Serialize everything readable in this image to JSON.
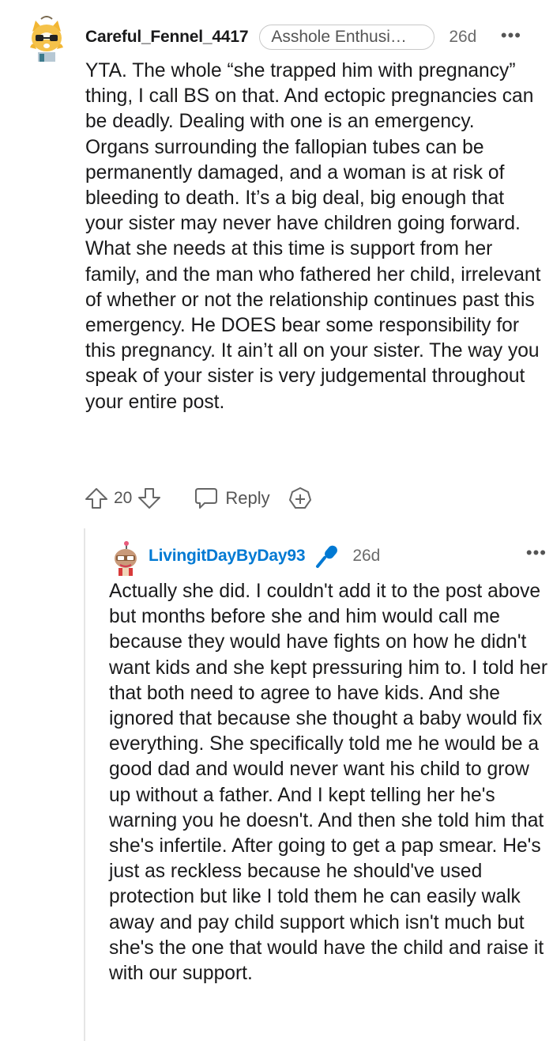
{
  "comment": {
    "username": "Careful_Fennel_4417",
    "flair": "Asshole Enthusi…",
    "time": "26d",
    "more": "•••",
    "body": "YTA. The whole “she trapped him with pregnancy” thing, I call BS on that. And ectopic pregnancies can be deadly. Dealing with one is an emergency. Organs surrounding the fallopian tubes can be permanently damaged, and a woman is at risk of bleeding to death. It’s a big deal, big enough that your sister may never have children going forward. What she needs at this time is support from her family, and the man who fathered her child, irrelevant of whether or not the relationship continues past this emergency. He DOES bear some responsibility for this pregnancy. It ain’t all on your sister. The way you speak of your sister is very judgemental throughout your entire post.",
    "vote_count": "20",
    "reply_label": "Reply",
    "icons": [
      "upvote-icon",
      "downvote-icon",
      "reply-icon",
      "award-icon"
    ]
  },
  "reply": {
    "username": "LivingitDayByDay93",
    "time": "26d",
    "more": "•••",
    "body": "Actually she did. I couldn't add it to the post above but months before she and him would call me because they would have fights on how he didn't want kids and she kept pressuring him to. I told her that both need to agree to have kids. And she ignored that because she thought a baby would fix everything. She specifically told me he would be a good dad and would never want his child to grow up without a father. And I kept telling her he's warning you he doesn't. And then she told him that she's infertile. After going to get a pap smear. He's just as reckless because he should've used protection but like I told them he can easily walk away and pay child support which isn't much but she's the one that would have the child and raise it with our support.",
    "icons": [
      "microphone-icon"
    ]
  },
  "colors": {
    "link_blue": "#0079d3",
    "text": "#1a1a1b",
    "muted": "#6a6a6a"
  }
}
